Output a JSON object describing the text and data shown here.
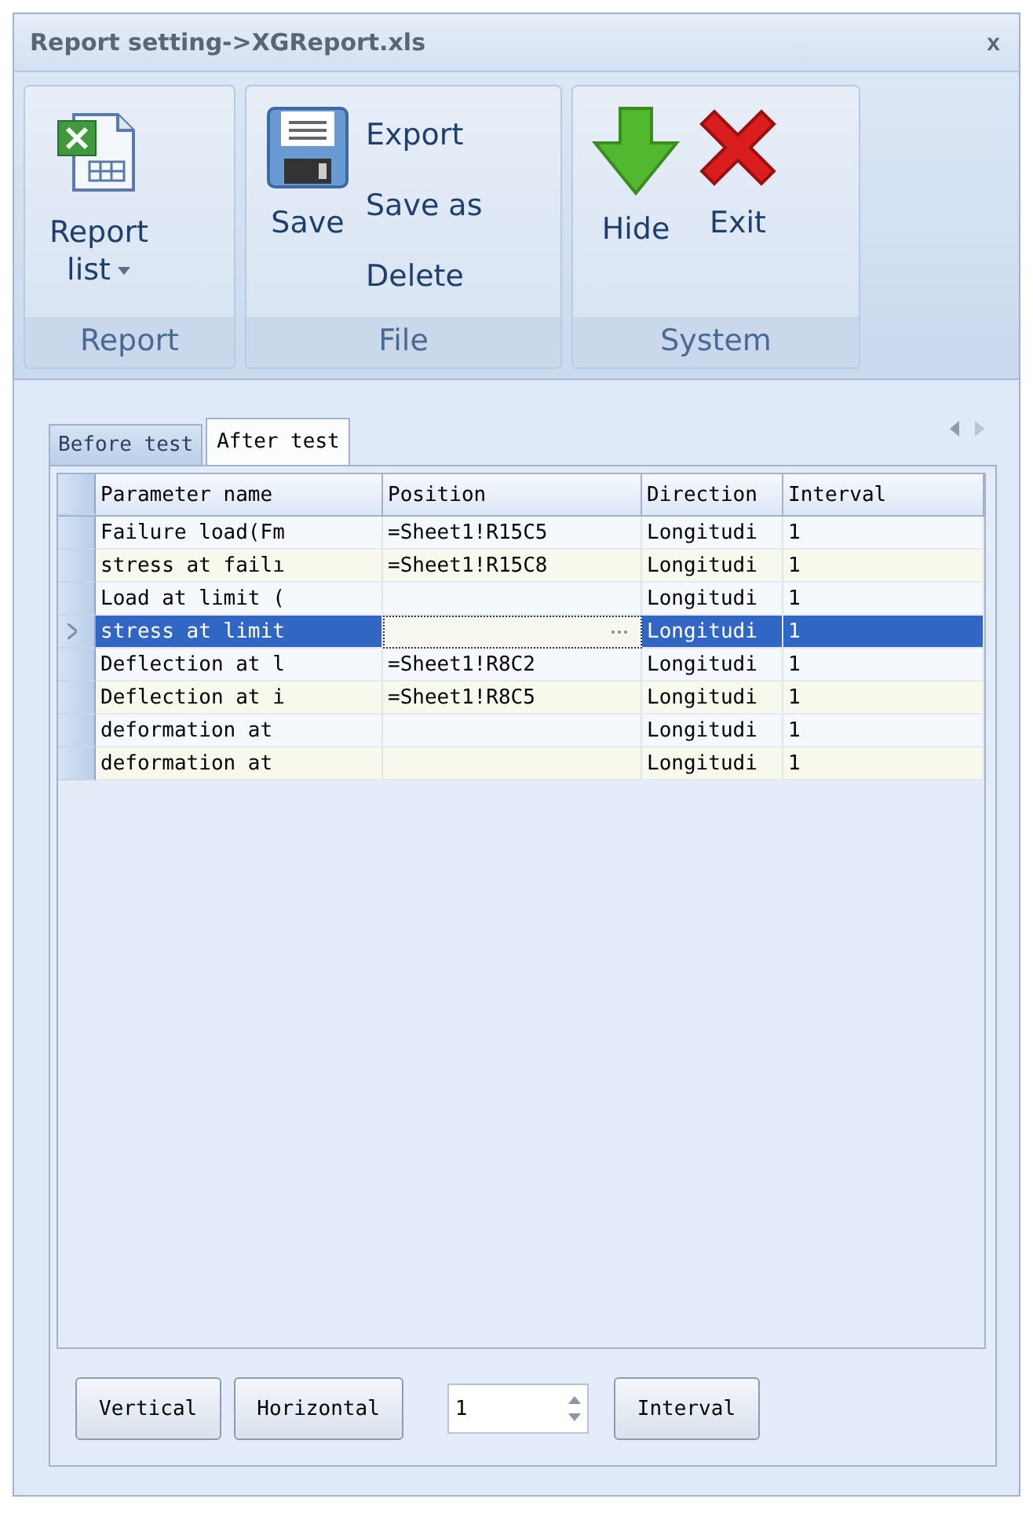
{
  "window": {
    "title": "Report setting->XGReport.xls",
    "close": "x"
  },
  "ribbon": {
    "groups": [
      {
        "label": "Report",
        "items": [
          {
            "kind": "large",
            "label": "Report list",
            "dropdown": true
          }
        ]
      },
      {
        "label": "File",
        "items": [
          {
            "kind": "large",
            "label": "Save",
            "dropdown": false
          },
          {
            "kind": "small",
            "label": "Export"
          },
          {
            "kind": "small",
            "label": "Save as"
          },
          {
            "kind": "small",
            "label": "Delete"
          }
        ]
      },
      {
        "label": "System",
        "items": [
          {
            "kind": "large",
            "label": "Hide",
            "dropdown": false
          },
          {
            "kind": "large",
            "label": "Exit",
            "dropdown": false
          }
        ]
      }
    ]
  },
  "tabs": [
    {
      "label": "Before test",
      "selected": false
    },
    {
      "label": "After test",
      "selected": true
    }
  ],
  "table": {
    "columns": [
      "Parameter name",
      "Position",
      "Direction",
      "Interval"
    ],
    "rows": [
      {
        "cells": [
          "Failure load(Fm",
          "=Sheet1!R15C5",
          "Longitudi",
          "1"
        ],
        "selected": false
      },
      {
        "cells": [
          "stress at failı",
          "=Sheet1!R15C8",
          "Longitudi",
          "1"
        ],
        "selected": false
      },
      {
        "cells": [
          "Load at limit (",
          "",
          "Longitudi",
          "1"
        ],
        "selected": false
      },
      {
        "cells": [
          "stress at limit",
          "",
          "Longitudi",
          "1"
        ],
        "selected": true
      },
      {
        "cells": [
          "Deflection at l",
          "=Sheet1!R8C2",
          "Longitudi",
          "1"
        ],
        "selected": false
      },
      {
        "cells": [
          "Deflection at i",
          "=Sheet1!R8C5",
          "Longitudi",
          "1"
        ],
        "selected": false
      },
      {
        "cells": [
          "deformation at",
          "",
          "Longitudi",
          "1"
        ],
        "selected": false
      },
      {
        "cells": [
          "deformation at",
          "",
          "Longitudi",
          "1"
        ],
        "selected": false
      }
    ]
  },
  "footer": {
    "vertical": "Vertical",
    "horizontal": "Horizontal",
    "spin_value": "1",
    "interval": "Interval"
  }
}
